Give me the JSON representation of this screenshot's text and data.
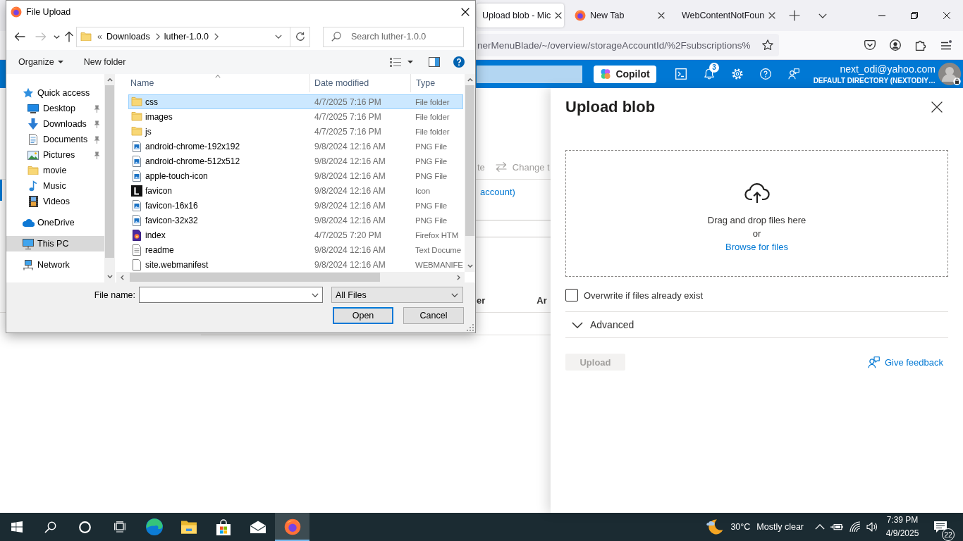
{
  "file_dialog": {
    "title": "File Upload",
    "nav_buttons": [
      {
        "kind": "back",
        "disabled": false
      },
      {
        "kind": "forward",
        "disabled": true
      },
      {
        "kind": "recent",
        "disabled": false
      },
      {
        "kind": "up",
        "disabled": false
      }
    ],
    "breadcrumb_overflow": "«",
    "breadcrumb": [
      "Downloads",
      "luther-1.0.0"
    ],
    "search": {
      "placeholder": "Search luther-1.0.0"
    },
    "commands": [
      {
        "label": "Organize",
        "menu": true
      },
      {
        "label": "New folder",
        "menu": false
      }
    ],
    "sidebar": [
      {
        "label": "Quick access",
        "kind": "star",
        "selected": false,
        "children": [
          {
            "label": "Desktop",
            "kind": "desktop",
            "pinned": true,
            "selected": false
          },
          {
            "label": "Downloads",
            "kind": "downloads",
            "pinned": true,
            "selected": false
          },
          {
            "label": "Documents",
            "kind": "documents",
            "pinned": true,
            "selected": false
          },
          {
            "label": "Pictures",
            "kind": "pictures",
            "pinned": true,
            "selected": false
          },
          {
            "label": "movie",
            "kind": "folder",
            "pinned": false,
            "selected": false
          },
          {
            "label": "Music",
            "kind": "music",
            "pinned": false,
            "selected": false
          },
          {
            "label": "Videos",
            "kind": "videos",
            "pinned": false,
            "selected": false
          }
        ]
      },
      {
        "label": "OneDrive",
        "kind": "cloud",
        "selected": false
      },
      {
        "label": "This PC",
        "kind": "pc",
        "selected": true
      },
      {
        "label": "Network",
        "kind": "network",
        "selected": false
      }
    ],
    "columns": [
      {
        "label": "Name",
        "sorted": true
      },
      {
        "label": "Date modified",
        "sorted": false
      },
      {
        "label": "Type",
        "sorted": false
      }
    ],
    "files": [
      {
        "name": "css",
        "kind": "folder",
        "date": "4/7/2025 7:16 PM",
        "type": "File folder",
        "selected": true
      },
      {
        "name": "images",
        "kind": "folder",
        "date": "4/7/2025 7:16 PM",
        "type": "File folder",
        "selected": false
      },
      {
        "name": "js",
        "kind": "folder",
        "date": "4/7/2025 7:16 PM",
        "type": "File folder",
        "selected": false
      },
      {
        "name": "android-chrome-192x192",
        "kind": "image",
        "date": "9/8/2024 12:16 AM",
        "type": "PNG File",
        "selected": false
      },
      {
        "name": "android-chrome-512x512",
        "kind": "image",
        "date": "9/8/2024 12:16 AM",
        "type": "PNG File",
        "selected": false
      },
      {
        "name": "apple-touch-icon",
        "kind": "image",
        "date": "9/8/2024 12:16 AM",
        "type": "PNG File",
        "selected": false
      },
      {
        "name": "favicon",
        "kind": "letter",
        "date": "9/8/2024 12:16 AM",
        "type": "Icon",
        "selected": false
      },
      {
        "name": "favicon-16x16",
        "kind": "image",
        "date": "9/8/2024 12:16 AM",
        "type": "PNG File",
        "selected": false
      },
      {
        "name": "favicon-32x32",
        "kind": "image",
        "date": "9/8/2024 12:16 AM",
        "type": "PNG File",
        "selected": false
      },
      {
        "name": "index",
        "kind": "webpage",
        "date": "4/7/2025 7:20 PM",
        "type": "Firefox HTM",
        "selected": false
      },
      {
        "name": "readme",
        "kind": "text",
        "date": "9/8/2024 12:16 AM",
        "type": "Text Docume",
        "selected": false
      },
      {
        "name": "site.webmanifest",
        "kind": "blank",
        "date": "9/8/2024 12:16 AM",
        "type": "WEBMANIFE",
        "selected": false
      }
    ],
    "file_name_label": "File name:",
    "filter": "All Files",
    "buttons": [
      {
        "label": "Open",
        "default": true
      },
      {
        "label": "Cancel",
        "default": false
      }
    ]
  },
  "browser": {
    "tabs": [
      {
        "title": "Upload blob - Mic",
        "selected": true,
        "favicon": false
      },
      {
        "title": "New Tab",
        "selected": false,
        "favicon": true
      },
      {
        "title": "WebContentNotFoun",
        "selected": false,
        "favicon": false
      }
    ],
    "address": "nerMenuBlade/~/overview/storageAccountId/%2Fsubscriptions%"
  },
  "portal_header": {
    "copilot": "Copilot",
    "notification_count": "3",
    "user": "next_odi@yahoo.com",
    "directory": "DEFAULT DIRECTORY (NEXTODIY…"
  },
  "background_page": {
    "commands": [
      {
        "label": "te",
        "disabled": true,
        "kind": "plain"
      },
      {
        "label": "Change t",
        "disabled": true,
        "kind": "swap"
      }
    ],
    "link": "account)",
    "columns": [
      "er",
      "Ar"
    ]
  },
  "upload_panel": {
    "title": "Upload blob",
    "drop_text": "Drag and drop files here",
    "or_text": "or",
    "browse_link": "Browse for files",
    "overwrite": {
      "label": "Overwrite if files already exist",
      "checked": false
    },
    "advanced": {
      "label": "Advanced",
      "expanded": false
    },
    "upload": {
      "label": "Upload",
      "disabled": true
    },
    "feedback": "Give feedback"
  },
  "taskbar": {
    "apps": [
      {
        "kind": "start",
        "selected": false
      },
      {
        "kind": "search",
        "selected": false
      },
      {
        "kind": "assistant",
        "selected": false
      },
      {
        "kind": "task-view",
        "selected": false
      },
      {
        "kind": "edge",
        "selected": false
      },
      {
        "kind": "explorer",
        "selected": false
      },
      {
        "kind": "store",
        "selected": false
      },
      {
        "kind": "mail",
        "selected": false
      },
      {
        "kind": "firefox",
        "selected": true
      }
    ],
    "temperature": "30°C",
    "weather": "Mostly clear",
    "time": "7:39 PM",
    "date": "4/9/2025",
    "notifications": "22"
  }
}
